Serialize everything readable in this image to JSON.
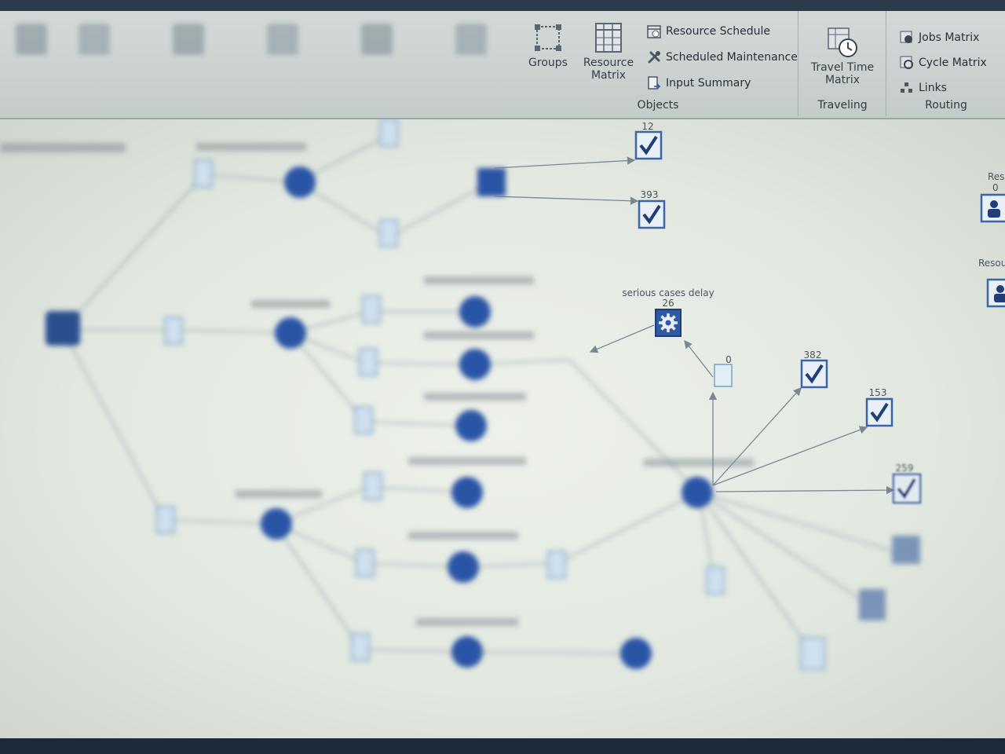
{
  "ribbon": {
    "objects": {
      "groups_label": "Groups",
      "resource_matrix_label": "Resource Matrix",
      "resource_schedule_label": "Resource Schedule",
      "scheduled_maintenance_label": "Scheduled Maintenance",
      "input_summary_label": "Input Summary",
      "group_label": "Objects"
    },
    "traveling": {
      "travel_time_matrix_label": "Travel Time Matrix",
      "group_label": "Traveling"
    },
    "routing": {
      "jobs_matrix_label": "Jobs Matrix",
      "cycle_matrix_label": "Cycle Matrix",
      "links_label": "Links",
      "group_label": "Routing"
    }
  },
  "canvas": {
    "labels": {
      "serious_cases_delay": "serious cases delay",
      "serious_cases_delay_count": "26",
      "queue_count": "0",
      "sink_1": "12",
      "sink_2": "393",
      "sink_3": "382",
      "sink_4": "153",
      "sink_5": "259",
      "resource_1": "Resourc",
      "resource_1_count": "0",
      "resource_2": "Resou"
    }
  },
  "colors": {
    "node": "#2f5aa3",
    "sink_border": "#3a66a8",
    "edge": "#7a8793"
  }
}
